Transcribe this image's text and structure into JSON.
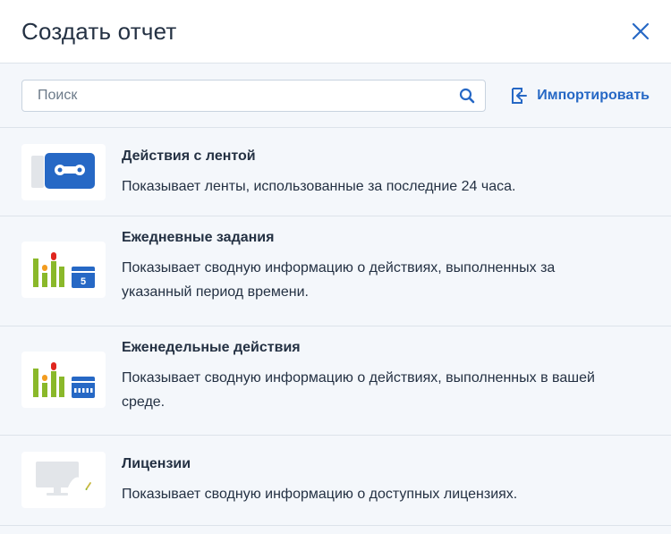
{
  "dialog": {
    "title": "Создать отчет"
  },
  "toolbar": {
    "search_placeholder": "Поиск",
    "import_label": "Импортировать"
  },
  "reports": [
    {
      "title": "Действия с лентой",
      "description": "Показывает ленты, использованные за последние 24 часа.",
      "icon": "tape-icon"
    },
    {
      "title": "Ежедневные задания",
      "description": "Показывает сводную информацию о действиях, выполненных за указанный период времени.",
      "icon": "daily-chart-calendar-icon",
      "calendar_day": "5"
    },
    {
      "title": "Еженедельные действия",
      "description": "Показывает сводную информацию о действиях, выполненных в вашей среде.",
      "icon": "weekly-chart-calendar-icon"
    },
    {
      "title": "Лицензии",
      "description": "Показывает сводную информацию о доступных лицензиях.",
      "icon": "license-monitor-icon"
    }
  ],
  "colors": {
    "accent": "#2668c5",
    "bar_green": "#8ab82a",
    "bar_orange": "#f39c1f",
    "bar_red": "#e0261e",
    "text": "#243143"
  }
}
